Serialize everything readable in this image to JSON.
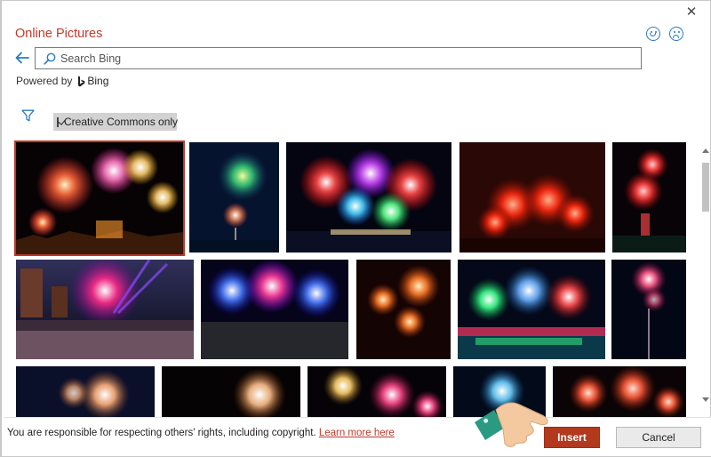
{
  "dialog": {
    "title": "Online Pictures",
    "close_icon": "close-icon",
    "feedback": {
      "smile_icon": "smile-icon",
      "frown_icon": "frown-icon"
    }
  },
  "search": {
    "placeholder": "Search Bing",
    "value": "",
    "powered_by": "Powered by",
    "provider": "Bing"
  },
  "filters": {
    "filter_icon": "filter-icon",
    "creative_commons_label": "Creative Commons only",
    "creative_commons_checked": true
  },
  "results": {
    "subject": "fireworks",
    "rows": [
      [
        {
          "selected": true
        },
        {
          "selected": false
        },
        {
          "selected": false
        },
        {
          "selected": false
        },
        {
          "selected": false
        }
      ],
      [
        {
          "selected": false
        },
        {
          "selected": false
        },
        {
          "selected": false
        },
        {
          "selected": false
        },
        {
          "selected": false
        }
      ],
      [
        {
          "selected": false
        },
        {
          "selected": false
        },
        {
          "selected": false
        },
        {
          "selected": false
        },
        {
          "selected": false
        }
      ]
    ]
  },
  "footer": {
    "notice": "You are responsible for respecting others' rights, including copyright.",
    "learn_more": "Learn more here",
    "insert_label": "Insert",
    "cancel_label": "Cancel"
  },
  "colors": {
    "accent": "#c0392b",
    "insert_button": "#b2391e",
    "link": "#c0392b",
    "icon_blue": "#2b79c2"
  }
}
